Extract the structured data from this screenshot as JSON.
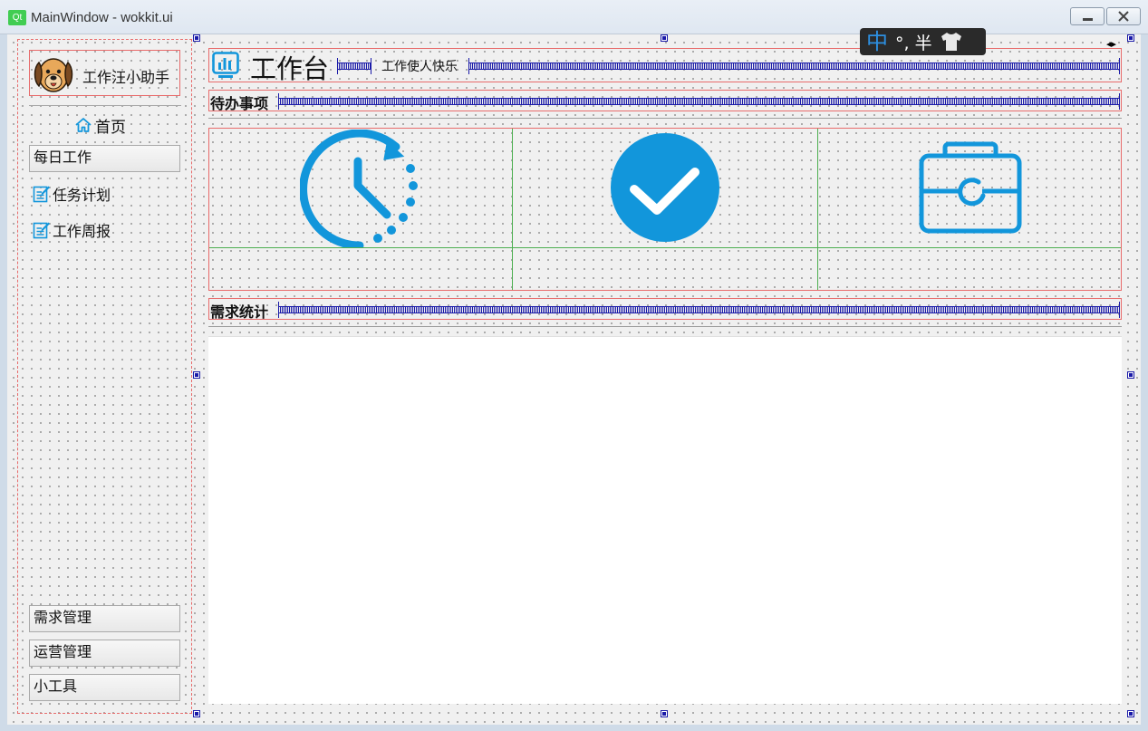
{
  "window": {
    "logo_text": "Qt",
    "title": "MainWindow - wokkit.ui"
  },
  "sidebar": {
    "brand_name": "工作汪小助手",
    "home_label": "首页",
    "items": [
      {
        "label": "每日工作",
        "type": "button"
      },
      {
        "label": "任务计划",
        "type": "link",
        "icon": "edit-icon"
      },
      {
        "label": "工作周报",
        "type": "link",
        "icon": "edit-icon"
      }
    ],
    "bottom_buttons": [
      {
        "label": "需求管理"
      },
      {
        "label": "运营管理"
      },
      {
        "label": "小工具"
      }
    ]
  },
  "header": {
    "title": "工作台",
    "subtitle": "工作使人快乐"
  },
  "sections": {
    "todo_label": "待办事项",
    "demand_label": "需求统计"
  },
  "todo_icons": [
    "clock-refresh-icon",
    "check-circle-icon",
    "toolbox-icon"
  ],
  "ime": {
    "mode": "中",
    "symbols": "°, 半"
  },
  "colors": {
    "accent": "#1296db",
    "selection_border": "#e86b6b",
    "layout_grid": "#4caf50",
    "spacer": "#1a1aa8"
  }
}
